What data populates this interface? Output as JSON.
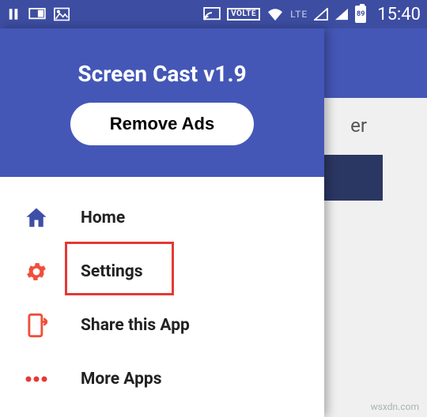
{
  "status_bar": {
    "time": "15:40",
    "lte_label": "LTE",
    "volte_label": "VOLTE",
    "battery_level": "89"
  },
  "background": {
    "peek_text": "er"
  },
  "drawer": {
    "title": "Screen Cast v1.9",
    "remove_ads_label": "Remove Ads",
    "menu": {
      "home": "Home",
      "settings": "Settings",
      "share": "Share this App",
      "more": "More Apps"
    }
  },
  "watermark": "wsxdn.com",
  "colors": {
    "primary": "#4457b7",
    "accent": "#f04f3a",
    "highlight": "#e53935"
  }
}
